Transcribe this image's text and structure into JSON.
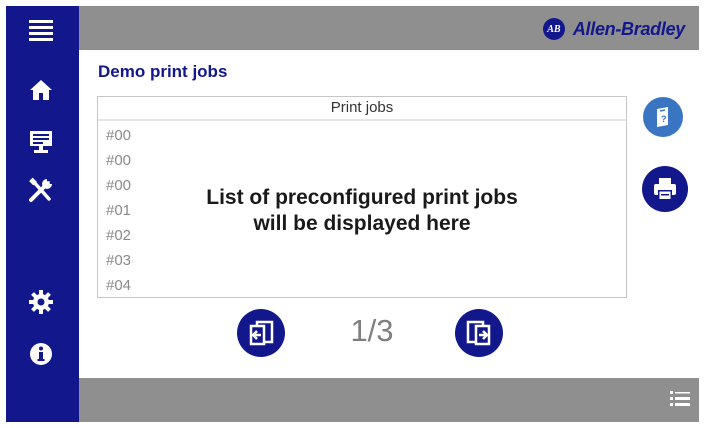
{
  "brand": {
    "name": "Allen-Bradley",
    "logo_text": "AB"
  },
  "page": {
    "title": "Demo print jobs"
  },
  "list": {
    "header": "Print jobs",
    "rows": [
      "#00",
      "#00",
      "#00",
      "#01",
      "#02",
      "#03",
      "#04"
    ],
    "placeholder_line1": "List of preconfigured print jobs",
    "placeholder_line2": "will be displayed here"
  },
  "pager": {
    "text": "1/3"
  },
  "sidebar": {
    "icons": [
      "menu-icon",
      "home-icon",
      "monitor-icon",
      "tools-icon",
      "settings-icon",
      "info-icon"
    ]
  },
  "colors": {
    "primary": "#12188c",
    "bar_gray": "#8f8f8f",
    "accent_blue": "#3a75c4"
  }
}
